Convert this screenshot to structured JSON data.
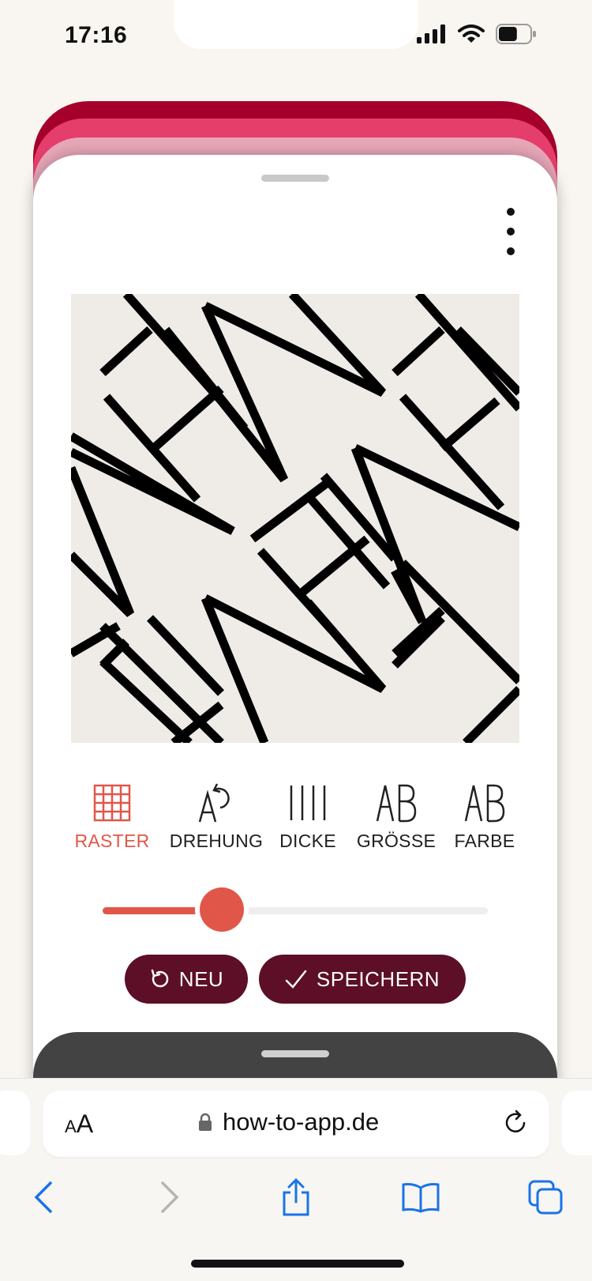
{
  "status_bar": {
    "time": "17:16",
    "battery_level": 0.6
  },
  "card_stack_colors": [
    "#a4002b",
    "#e53d6c",
    "#e7a7b8"
  ],
  "accent_color": "#e0574a",
  "button_color": "#5c0f27",
  "editor": {
    "more_icon": "more-vertical-icon",
    "tools": [
      {
        "label": "RASTER",
        "icon": "grid-icon",
        "active": true
      },
      {
        "label": "DREHUNG",
        "icon": "rotate-text-icon",
        "active": false
      },
      {
        "label": "DICKE",
        "icon": "line-thickness-icon",
        "active": false
      },
      {
        "label": "GRÖSSE",
        "icon": "text-size-icon",
        "active": false
      },
      {
        "label": "FARBE",
        "icon": "text-color-icon",
        "active": false
      }
    ],
    "slider_value": 0.31,
    "buttons": {
      "new_label": "NEU",
      "save_label": "SPEICHERN"
    }
  },
  "browser": {
    "text_size_label_small": "A",
    "text_size_label_large": "A",
    "url": "how-to-app.de"
  }
}
